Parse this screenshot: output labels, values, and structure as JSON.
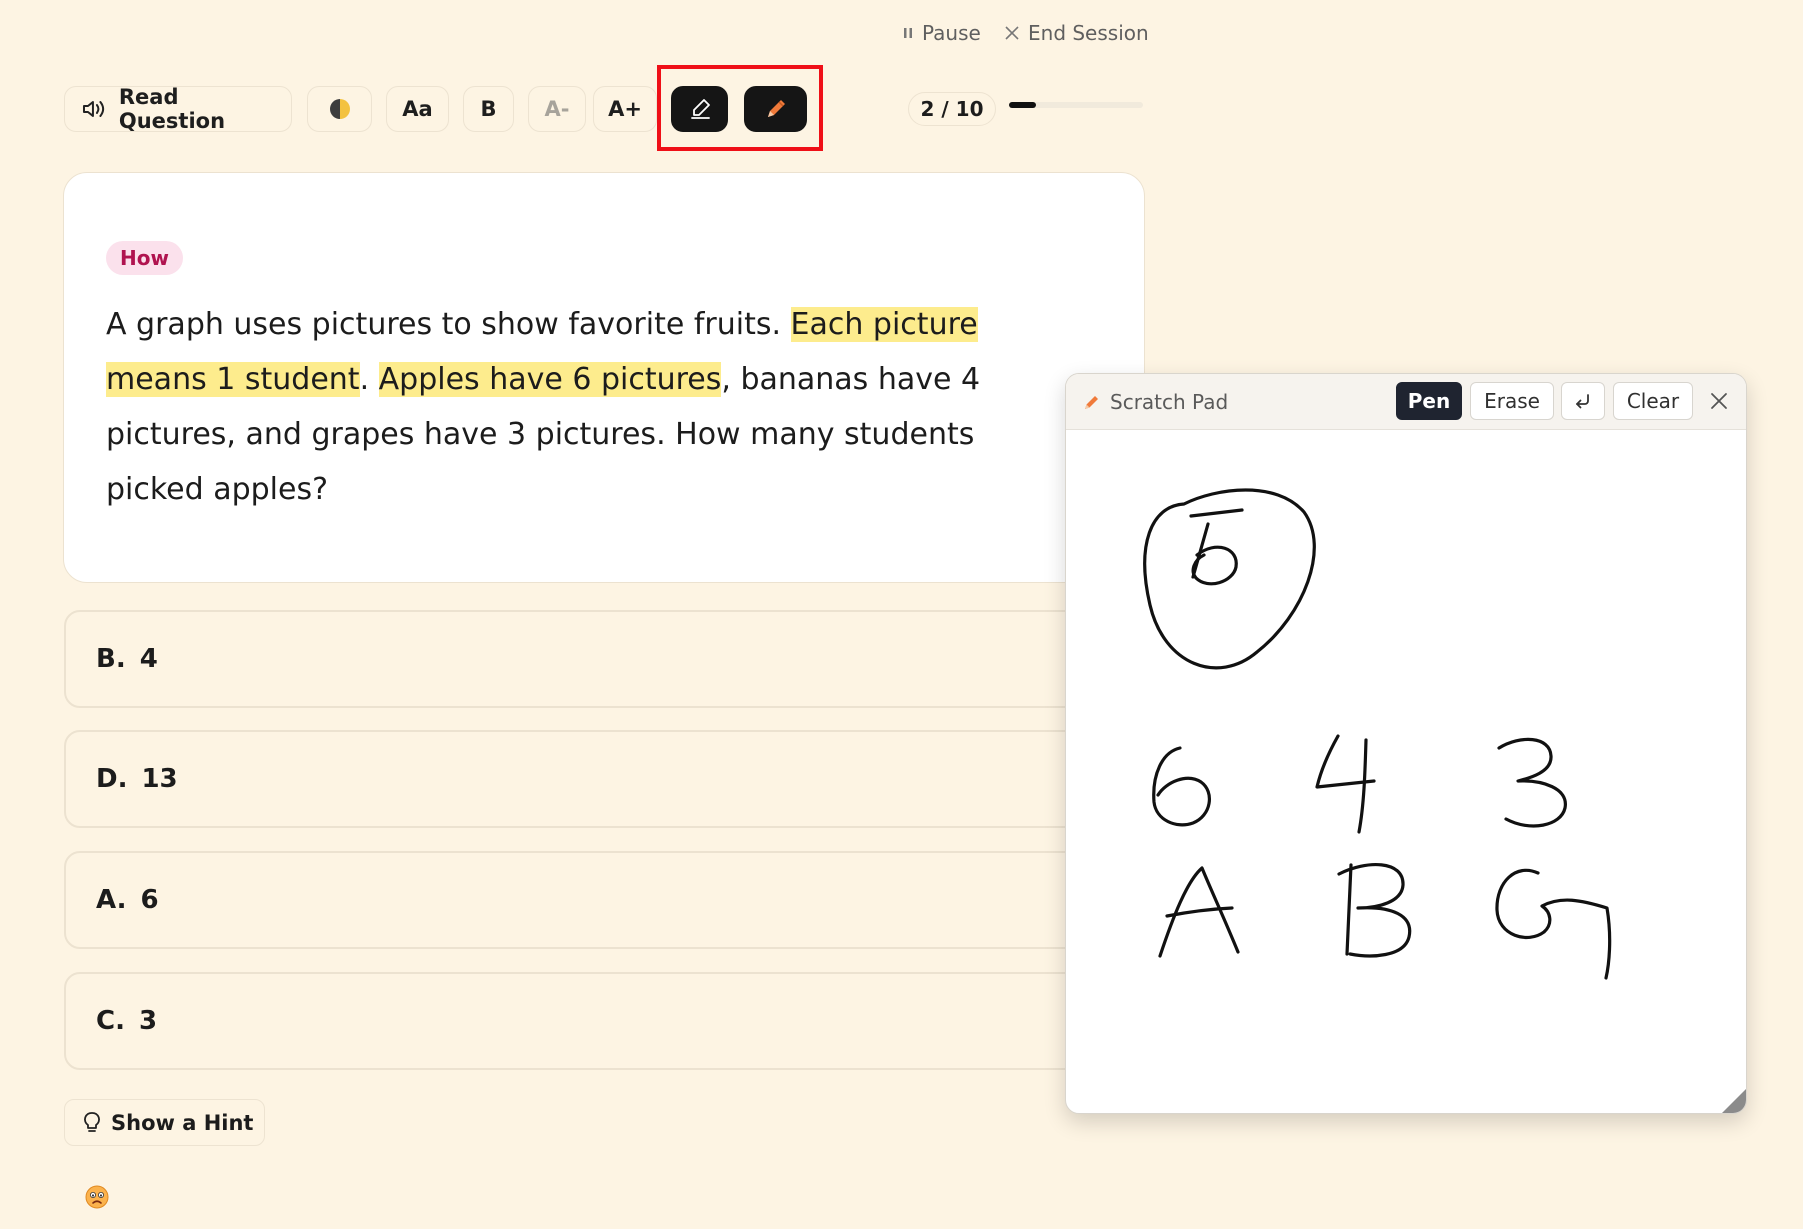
{
  "session": {
    "pause_label": "Pause",
    "end_label": "End Session"
  },
  "toolbar": {
    "read_label": "Read Question",
    "font_label": "Aa",
    "bold_label": "B",
    "decrease_label": "A-",
    "increase_label": "A+"
  },
  "progress": {
    "label": "2 / 10",
    "fraction": 0.2
  },
  "question": {
    "tag": "How",
    "segments": [
      {
        "text": "A graph uses pictures to show favorite fruits. ",
        "highlight": false
      },
      {
        "text": "Each picture means 1 student",
        "highlight": true
      },
      {
        "text": ". ",
        "highlight": false
      },
      {
        "text": "Apples have 6 pictures",
        "highlight": true
      },
      {
        "text": ", bananas have 4 pictures, and grapes have 3 pictures. How many students picked apples?",
        "highlight": false
      }
    ]
  },
  "answers": [
    {
      "letter": "B.",
      "value": "4"
    },
    {
      "letter": "D.",
      "value": "13"
    },
    {
      "letter": "A.",
      "value": "6"
    },
    {
      "letter": "C.",
      "value": "3"
    }
  ],
  "hint_label": "Show a Hint",
  "scratch_pad": {
    "title": "Scratch Pad",
    "pen_label": "Pen",
    "erase_label": "Erase",
    "clear_label": "Clear",
    "active_tool": "Pen"
  },
  "icons": {
    "read": "speaker-icon",
    "contrast": "contrast-icon",
    "highlighter": "highlighter-icon",
    "pencil": "pencil-icon",
    "undo": "undo-icon",
    "close": "close-icon",
    "hint": "lightbulb-icon",
    "pause": "pause-icon",
    "end": "x-icon",
    "emoji": "worried-face-icon"
  },
  "colors": {
    "background": "#fdf4e3",
    "highlight": "#fdec8d",
    "tag_text": "#b0134f",
    "annotation_box": "#ef0f17",
    "accent_orange": "#f07a3a"
  }
}
